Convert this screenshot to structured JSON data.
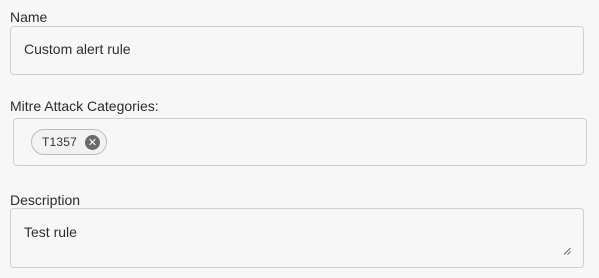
{
  "name_section": {
    "label": "Name",
    "value": "Custom alert rule"
  },
  "mitre_section": {
    "label": "Mitre Attack Categories:",
    "chips": [
      {
        "label": "T1357",
        "remove_icon": "close-circle-icon"
      }
    ]
  },
  "description_section": {
    "label": "Description",
    "value": "Test rule",
    "resize_icon": "resize-handle-icon"
  }
}
